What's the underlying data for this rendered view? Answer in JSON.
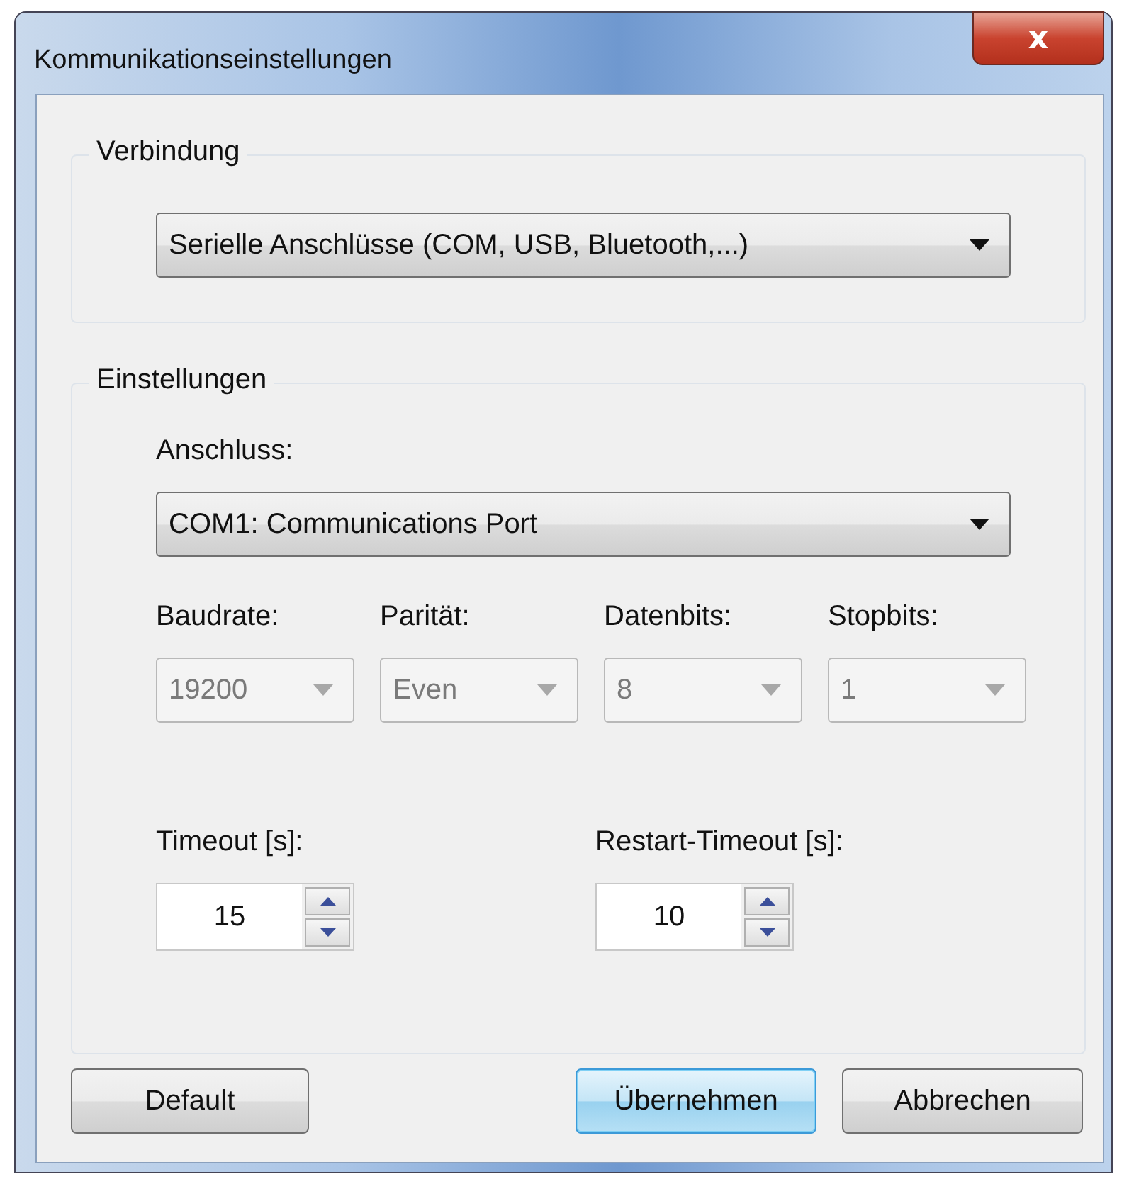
{
  "window": {
    "title": "Kommunikationseinstellungen",
    "close": "x"
  },
  "connection": {
    "legend": "Verbindung",
    "value": "Serielle Anschlüsse (COM, USB, Bluetooth,...)"
  },
  "settings": {
    "legend": "Einstellungen",
    "port_label": "Anschluss:",
    "port_value": "COM1: Communications Port",
    "combos": [
      {
        "label": "Baudrate:",
        "value": "19200",
        "disabled": true
      },
      {
        "label": "Parität:",
        "value": "Even",
        "disabled": true
      },
      {
        "label": "Datenbits:",
        "value": "8",
        "disabled": true
      },
      {
        "label": "Stopbits:",
        "value": "1",
        "disabled": true
      }
    ],
    "spinners": [
      {
        "label": "Timeout [s]:",
        "value": "15"
      },
      {
        "label": "Restart-Timeout [s]:",
        "value": "10"
      }
    ]
  },
  "buttons": [
    {
      "label": "Default",
      "focused": false
    },
    {
      "label": "Übernehmen",
      "focused": true
    },
    {
      "label": "Abbrechen",
      "focused": false
    }
  ]
}
